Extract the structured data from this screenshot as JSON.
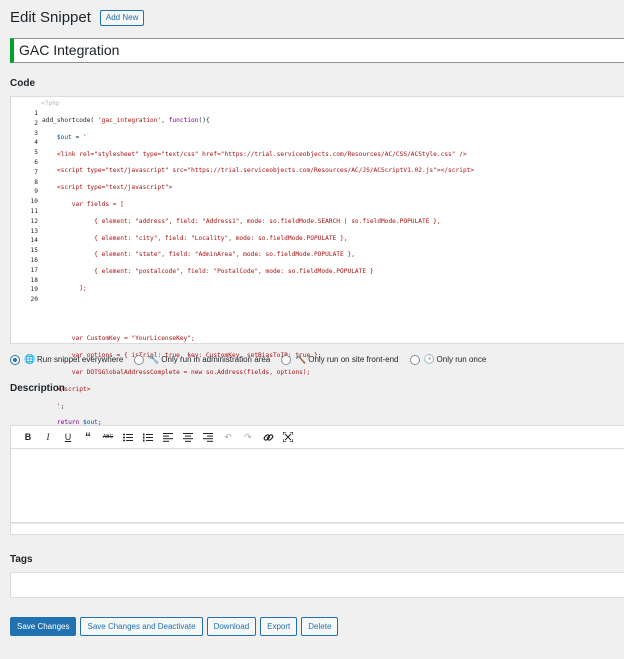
{
  "header": {
    "title": "Edit Snippet",
    "add_new_label": "Add New"
  },
  "snippet": {
    "name": "GAC Integration",
    "accent_color": "#00a32a"
  },
  "code_section": {
    "label": "Code",
    "open_tag": "<?php",
    "line_numbers": [
      "1",
      "2",
      "3",
      "4",
      "5",
      "6",
      "7",
      "8",
      "9",
      "10",
      "11",
      "12",
      "13",
      "14",
      "15",
      "16",
      "17",
      "18",
      "19",
      "20"
    ]
  },
  "scope": {
    "options": [
      {
        "label": "Run snippet everywhere",
        "icon": "globe-icon",
        "checked": true
      },
      {
        "label": "Only run in administration area",
        "icon": "wrench-icon",
        "checked": false
      },
      {
        "label": "Only run on site front-end",
        "icon": "hammer-icon",
        "checked": false
      },
      {
        "label": "Only run once",
        "icon": "clock-icon",
        "checked": false
      }
    ]
  },
  "description": {
    "label": "Description",
    "toolbar_icons": [
      "bold-icon",
      "italic-icon",
      "underline-icon",
      "blockquote-icon",
      "strikethrough-icon",
      "bullet-list-icon",
      "numbered-list-icon",
      "align-left-icon",
      "align-center-icon",
      "align-right-icon",
      "undo-icon",
      "redo-icon",
      "link-icon",
      "fullscreen-icon"
    ],
    "value": ""
  },
  "tags": {
    "label": "Tags",
    "value": ""
  },
  "actions": {
    "save": "Save Changes",
    "save_deactivate": "Save Changes and Deactivate",
    "download": "Download",
    "export": "Export",
    "delete": "Delete"
  },
  "colors": {
    "primary": "#2271b1",
    "keyword": "#770088",
    "string": "#aa1111",
    "variable": "#0055aa"
  }
}
